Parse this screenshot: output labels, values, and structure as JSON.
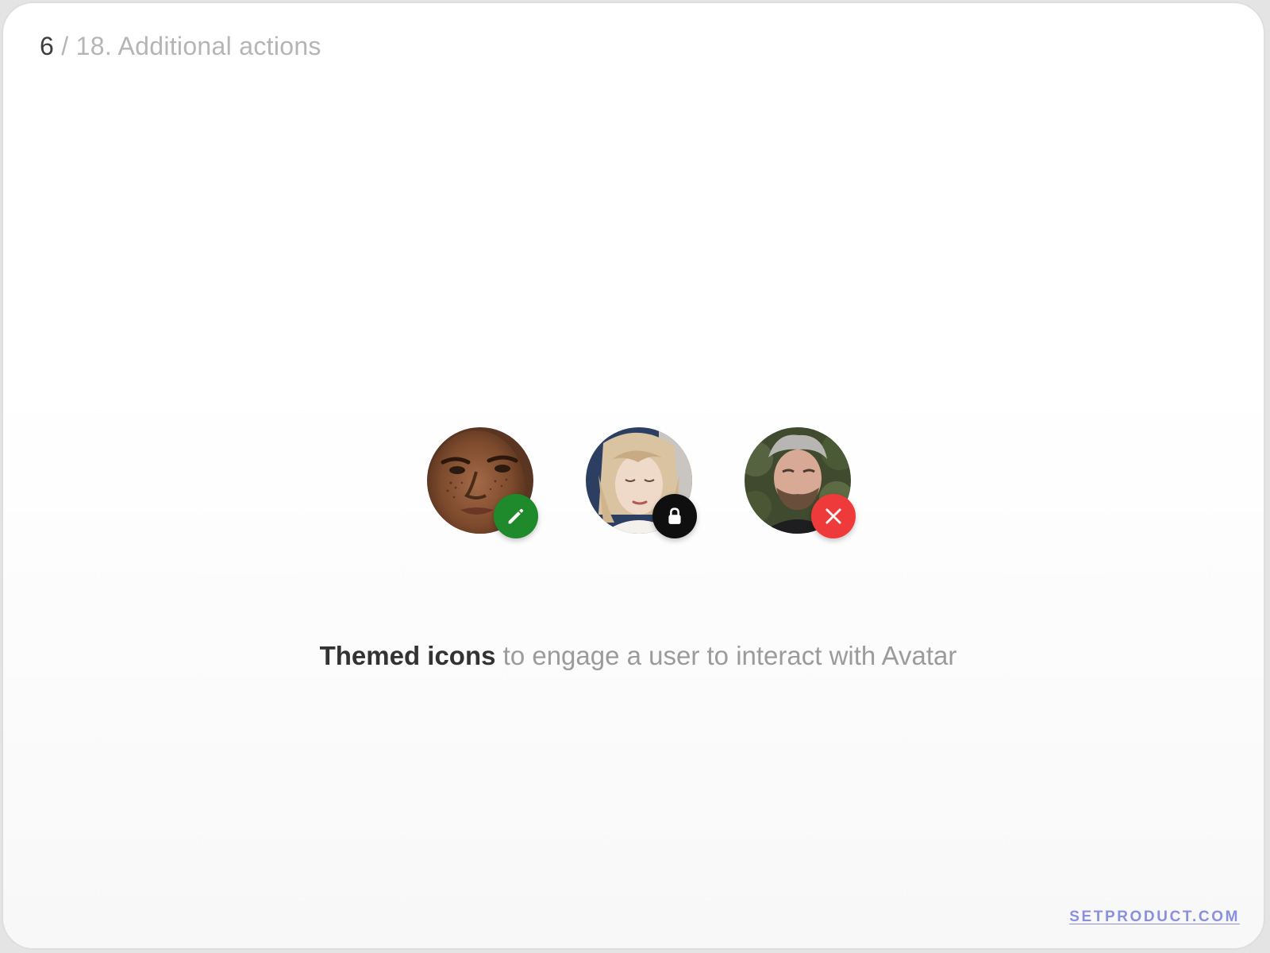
{
  "header": {
    "current": "6",
    "rest": " / 18. Additional actions"
  },
  "avatars": [
    {
      "person": "man-with-freckles-photo",
      "action": "edit",
      "icon": "pencil-icon",
      "badge_color": "#1e8a2b"
    },
    {
      "person": "blonde-woman-photo",
      "action": "lock",
      "icon": "lock-icon",
      "badge_color": "#0f0f0f"
    },
    {
      "person": "bearded-man-photo",
      "action": "remove",
      "icon": "close-icon",
      "badge_color": "#ee3a3a"
    }
  ],
  "caption": {
    "strong": "Themed icons",
    "light": " to engage a user to interact with Avatar"
  },
  "footer": {
    "link": "SETPRODUCT.COM"
  },
  "colors": {
    "accent_link": "#8a8fe0",
    "edit_green": "#1e8a2b",
    "lock_black": "#0f0f0f",
    "remove_red": "#ee3a3a"
  }
}
